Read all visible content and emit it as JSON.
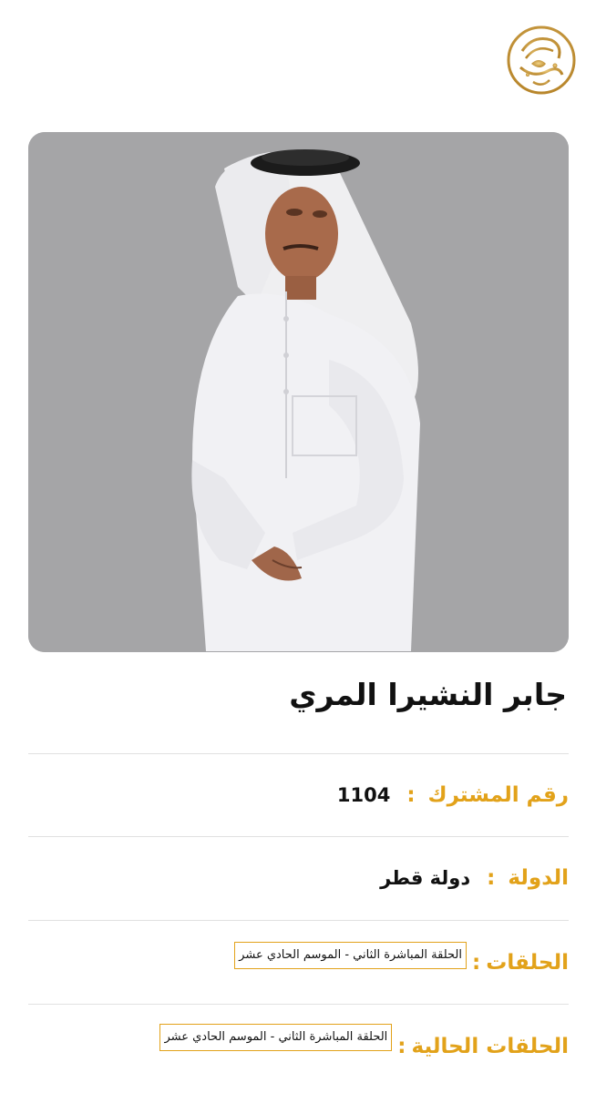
{
  "contestant": {
    "name": "جابر النشيرا المري",
    "fields": {
      "subscriber_label": "رقم المشترك",
      "subscriber_value": "1104",
      "country_label": "الدولة",
      "country_value": "دولة قطر",
      "episodes_label": "الحلقات",
      "episodes_value": "الحلقة المباشرة الثاني - الموسم الحادي عشر",
      "current_label": "الحلقات الحالية",
      "current_value": "الحلقة المباشرة الثاني - الموسم الحادي عشر"
    },
    "separator": ":"
  },
  "colors": {
    "accent": "#e2a21a",
    "photo_bg": "#a5a5a7"
  },
  "icons": {
    "logo": "gold-calligraphy-logo-icon"
  }
}
